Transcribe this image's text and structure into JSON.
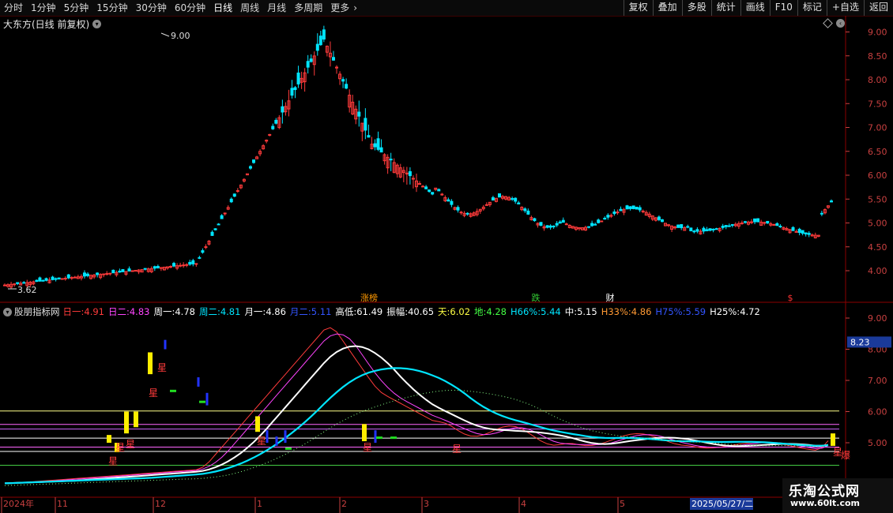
{
  "toolbar": {
    "periods": [
      "分时",
      "1分钟",
      "5分钟",
      "15分钟",
      "30分钟",
      "60分钟",
      "日线",
      "周线",
      "月线",
      "多周期",
      "更多"
    ],
    "active_period": "日线",
    "more_arrow": "›",
    "right_buttons": [
      "复权",
      "叠加",
      "多股",
      "统计",
      "画线",
      "F10",
      "标记",
      "+自选",
      "返回"
    ]
  },
  "main_chart": {
    "title": "大东方(日线 前复权)",
    "title_icon": "chevron-down-icon",
    "high_label": "9.00",
    "low_label": "3.62",
    "y_ticks": [
      "9.00",
      "8.50",
      "8.00",
      "7.50",
      "7.00",
      "6.50",
      "6.00",
      "5.50",
      "5.00",
      "4.50",
      "4.00"
    ],
    "markers": [
      {
        "text": "涨榜",
        "color": "#ff9900"
      },
      {
        "text": "跌",
        "color": "#33cc33"
      },
      {
        "text": "财",
        "color": "#ffffff"
      },
      {
        "text": "$",
        "color": "#ff3333"
      }
    ],
    "colors": {
      "up": "#ff3b3b",
      "down": "#00e5ff"
    }
  },
  "indicator": {
    "name": "股朋指标网",
    "values": [
      {
        "label": "日一:",
        "value": "4.91",
        "color": "#ff3b3b"
      },
      {
        "label": "日二:",
        "value": "4.83",
        "color": "#ff44ff"
      },
      {
        "label": "周一:",
        "value": "4.78",
        "color": "#ffffff"
      },
      {
        "label": "周二:",
        "value": "4.81",
        "color": "#00e5ff"
      },
      {
        "label": "月一:",
        "value": "4.86",
        "color": "#ffffff"
      },
      {
        "label": "月二:",
        "value": "5.11",
        "color": "#3355ff"
      },
      {
        "label": "高低:",
        "value": "61.49",
        "color": "#ffffff"
      },
      {
        "label": "振幅:",
        "value": "40.65",
        "color": "#ffffff"
      },
      {
        "label": "天:",
        "value": "6.02",
        "color": "#ffff44"
      },
      {
        "label": "地:",
        "value": "4.28",
        "color": "#44ff44"
      },
      {
        "label": "H66%:",
        "value": "5.44",
        "color": "#00e5ff"
      },
      {
        "label": "中:",
        "value": "5.15",
        "color": "#ffffff"
      },
      {
        "label": "H33%:",
        "value": "4.86",
        "color": "#ff9933"
      },
      {
        "label": "H75%:",
        "value": "5.59",
        "color": "#3355ff"
      },
      {
        "label": "H25%:",
        "value": "4.72",
        "color": "#ffffff"
      }
    ],
    "y_ticks": [
      "9.00",
      "8.00",
      "7.00",
      "6.00",
      "5.00"
    ],
    "current_price": "8.23",
    "star_label": "星",
    "bao_label": "爆"
  },
  "x_axis": {
    "labels": [
      "2024年",
      "11",
      "12",
      "1",
      "2",
      "3",
      "4",
      "5"
    ],
    "cursor_date": "2025/05/27/二"
  },
  "watermark": {
    "name": "乐淘公式网",
    "url": "www.60lt.com"
  }
}
